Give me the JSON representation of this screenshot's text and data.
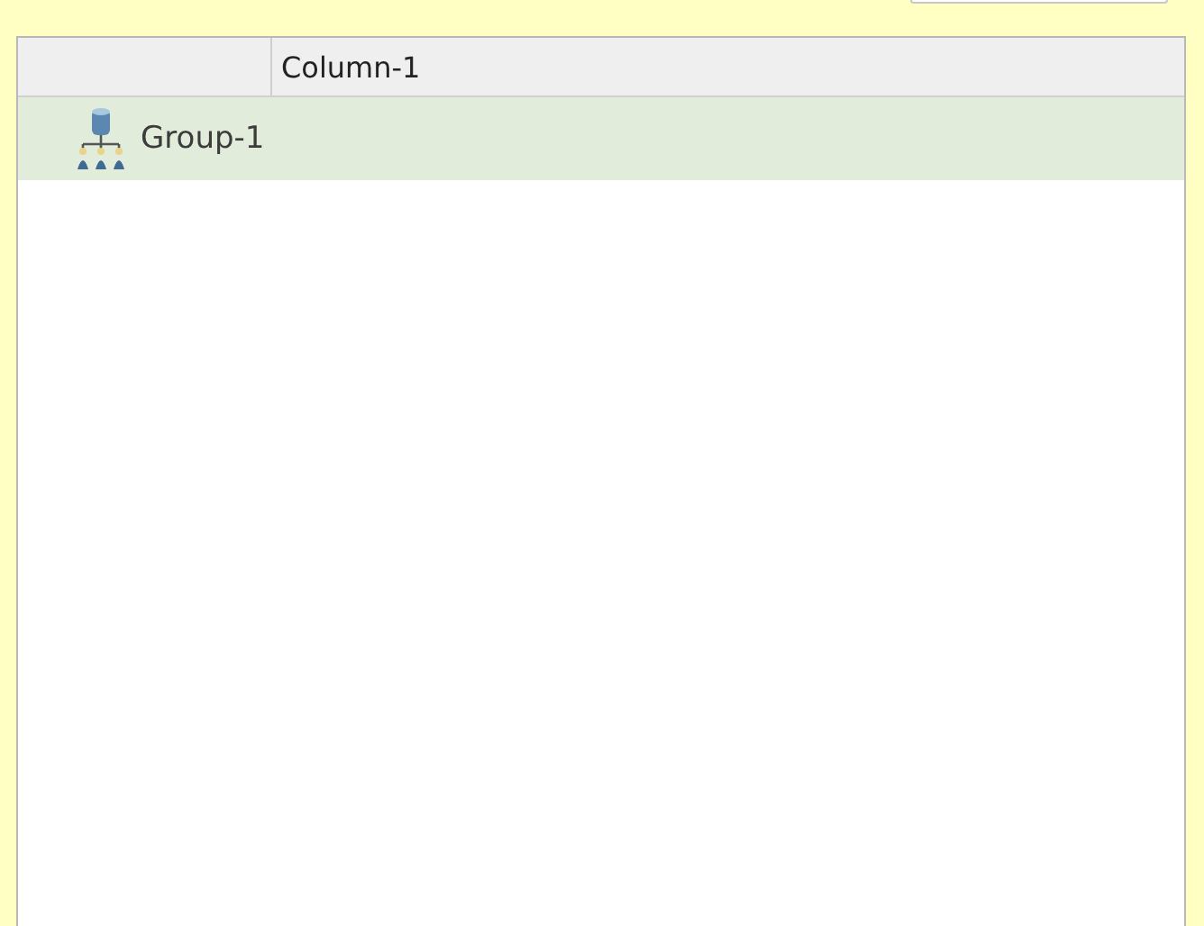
{
  "table": {
    "columns": [
      {},
      {
        "label": "Column-1"
      }
    ],
    "rows": [
      {
        "label": "Group-1",
        "selected": true
      }
    ]
  }
}
